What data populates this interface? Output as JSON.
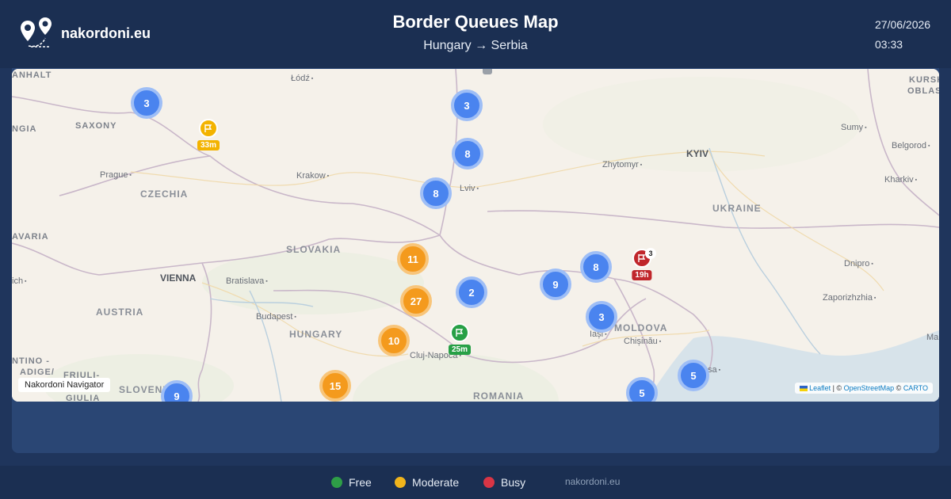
{
  "header": {
    "brand": "nakordoni.eu",
    "title": "Border Queues Map",
    "subtitle": "Hungary → Serbia",
    "date": "27/06/2026",
    "time": "03:33"
  },
  "map": {
    "labels": {
      "countries": [
        "CZECHIA",
        "SLOVAKIA",
        "AUSTRIA",
        "HUNGARY",
        "UKRAINE",
        "MOLDOVA",
        "ROMANIA",
        "SLOVENIA"
      ],
      "regions": [
        "SAXONY",
        "ANHALT",
        "NGIA",
        "AVARIA",
        "KURSK",
        "OBLAS",
        "NTINO -",
        "ADIGE/",
        "FRIULI-",
        "GIULIA"
      ],
      "capitals": [
        "VIENNA",
        "KYIV"
      ],
      "cities": [
        "Łódź",
        "Prague",
        "Krakow",
        "Lviv",
        "Zhytomyr",
        "Sumy",
        "Belgorod",
        "Kharkiv",
        "Bratislava",
        "Budapest",
        "Cluj-Napoca",
        "Iași",
        "Chișinău",
        "Dnipro",
        "Zaporizhzhia",
        "ich",
        "sa",
        "Mar"
      ]
    },
    "clusters": [
      {
        "count": "3",
        "color": "blue"
      },
      {
        "count": "3",
        "color": "blue"
      },
      {
        "count": "8",
        "color": "blue"
      },
      {
        "count": "8",
        "color": "blue"
      },
      {
        "count": "11",
        "color": "orange"
      },
      {
        "count": "2",
        "color": "blue"
      },
      {
        "count": "27",
        "color": "orange"
      },
      {
        "count": "9",
        "color": "blue"
      },
      {
        "count": "8",
        "color": "blue"
      },
      {
        "count": "3",
        "color": "blue"
      },
      {
        "count": "10",
        "color": "orange"
      },
      {
        "count": "15",
        "color": "orange"
      },
      {
        "count": "5",
        "color": "blue"
      },
      {
        "count": "5",
        "color": "blue"
      },
      {
        "count": "9",
        "color": "blue"
      }
    ],
    "markers": [
      {
        "wait": "33m",
        "status": "moderate",
        "color": "#f3b300"
      },
      {
        "wait": "25m",
        "status": "free",
        "color": "#27a046"
      },
      {
        "wait": "19h",
        "status": "busy",
        "color": "#c0262b",
        "count": "3"
      }
    ],
    "navigator_label": "Nakordoni Navigator",
    "attribution": {
      "leaflet": "Leaflet",
      "sep1": " | © ",
      "osm": "OpenStreetMap",
      "sep2": " © ",
      "carto": "CARTO"
    }
  },
  "legend": [
    {
      "label": "Free",
      "color": "#2e9e47"
    },
    {
      "label": "Moderate",
      "color": "#f0b41c"
    },
    {
      "label": "Busy",
      "color": "#d93545"
    }
  ],
  "footer_site": "nakordoni.eu"
}
